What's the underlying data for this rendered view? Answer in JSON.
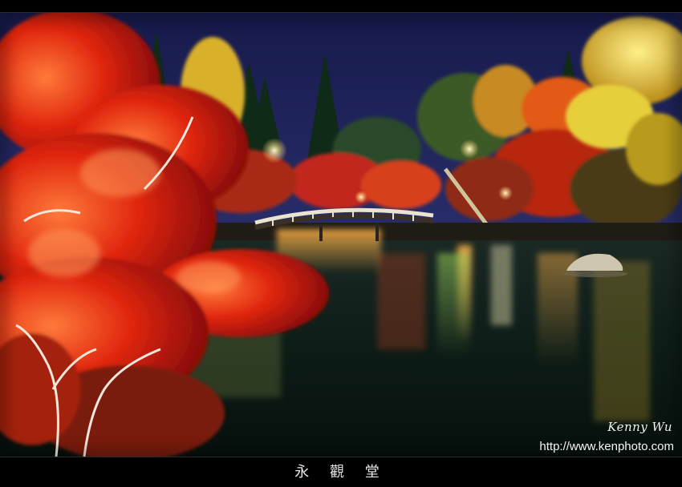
{
  "photo": {
    "subject": "night-illuminated autumn garden with pond and arched bridge",
    "colors": {
      "sky": "#1c1f55",
      "water": "#0c1a16",
      "maple_red": "#d61e0c",
      "maple_orange": "#f06418",
      "ginkgo_yellow": "#e8c82a",
      "conifer": "#13331a"
    }
  },
  "watermark": {
    "signature": "Kenny Wu",
    "url": "http://www.kenphoto.com"
  },
  "caption": {
    "title": "永 觀 堂"
  }
}
